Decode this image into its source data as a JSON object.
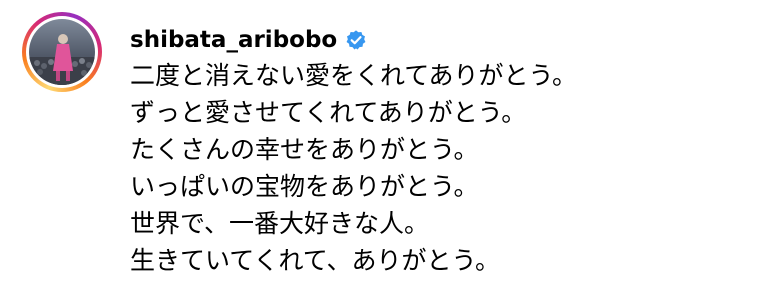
{
  "post": {
    "username": "shibata_aribobo",
    "verified_icon": "verified-badge-icon",
    "verified_color": "#3797f0",
    "trailing_glyph": "",
    "avatar_icon": "profile-photo-avatar",
    "avatar_ring_colors": [
      "#feda75",
      "#fa7e1e",
      "#d62976",
      "#962fbf"
    ],
    "caption_lines": [
      "二度と消えない愛をくれてありがとう。",
      "ずっと愛させてくれてありがとう。",
      "たくさんの幸せをありがとう。",
      "いっぱいの宝物をありがとう。",
      "世界で、一番大好きな人。",
      "生きていてくれて、ありがとう。"
    ]
  }
}
